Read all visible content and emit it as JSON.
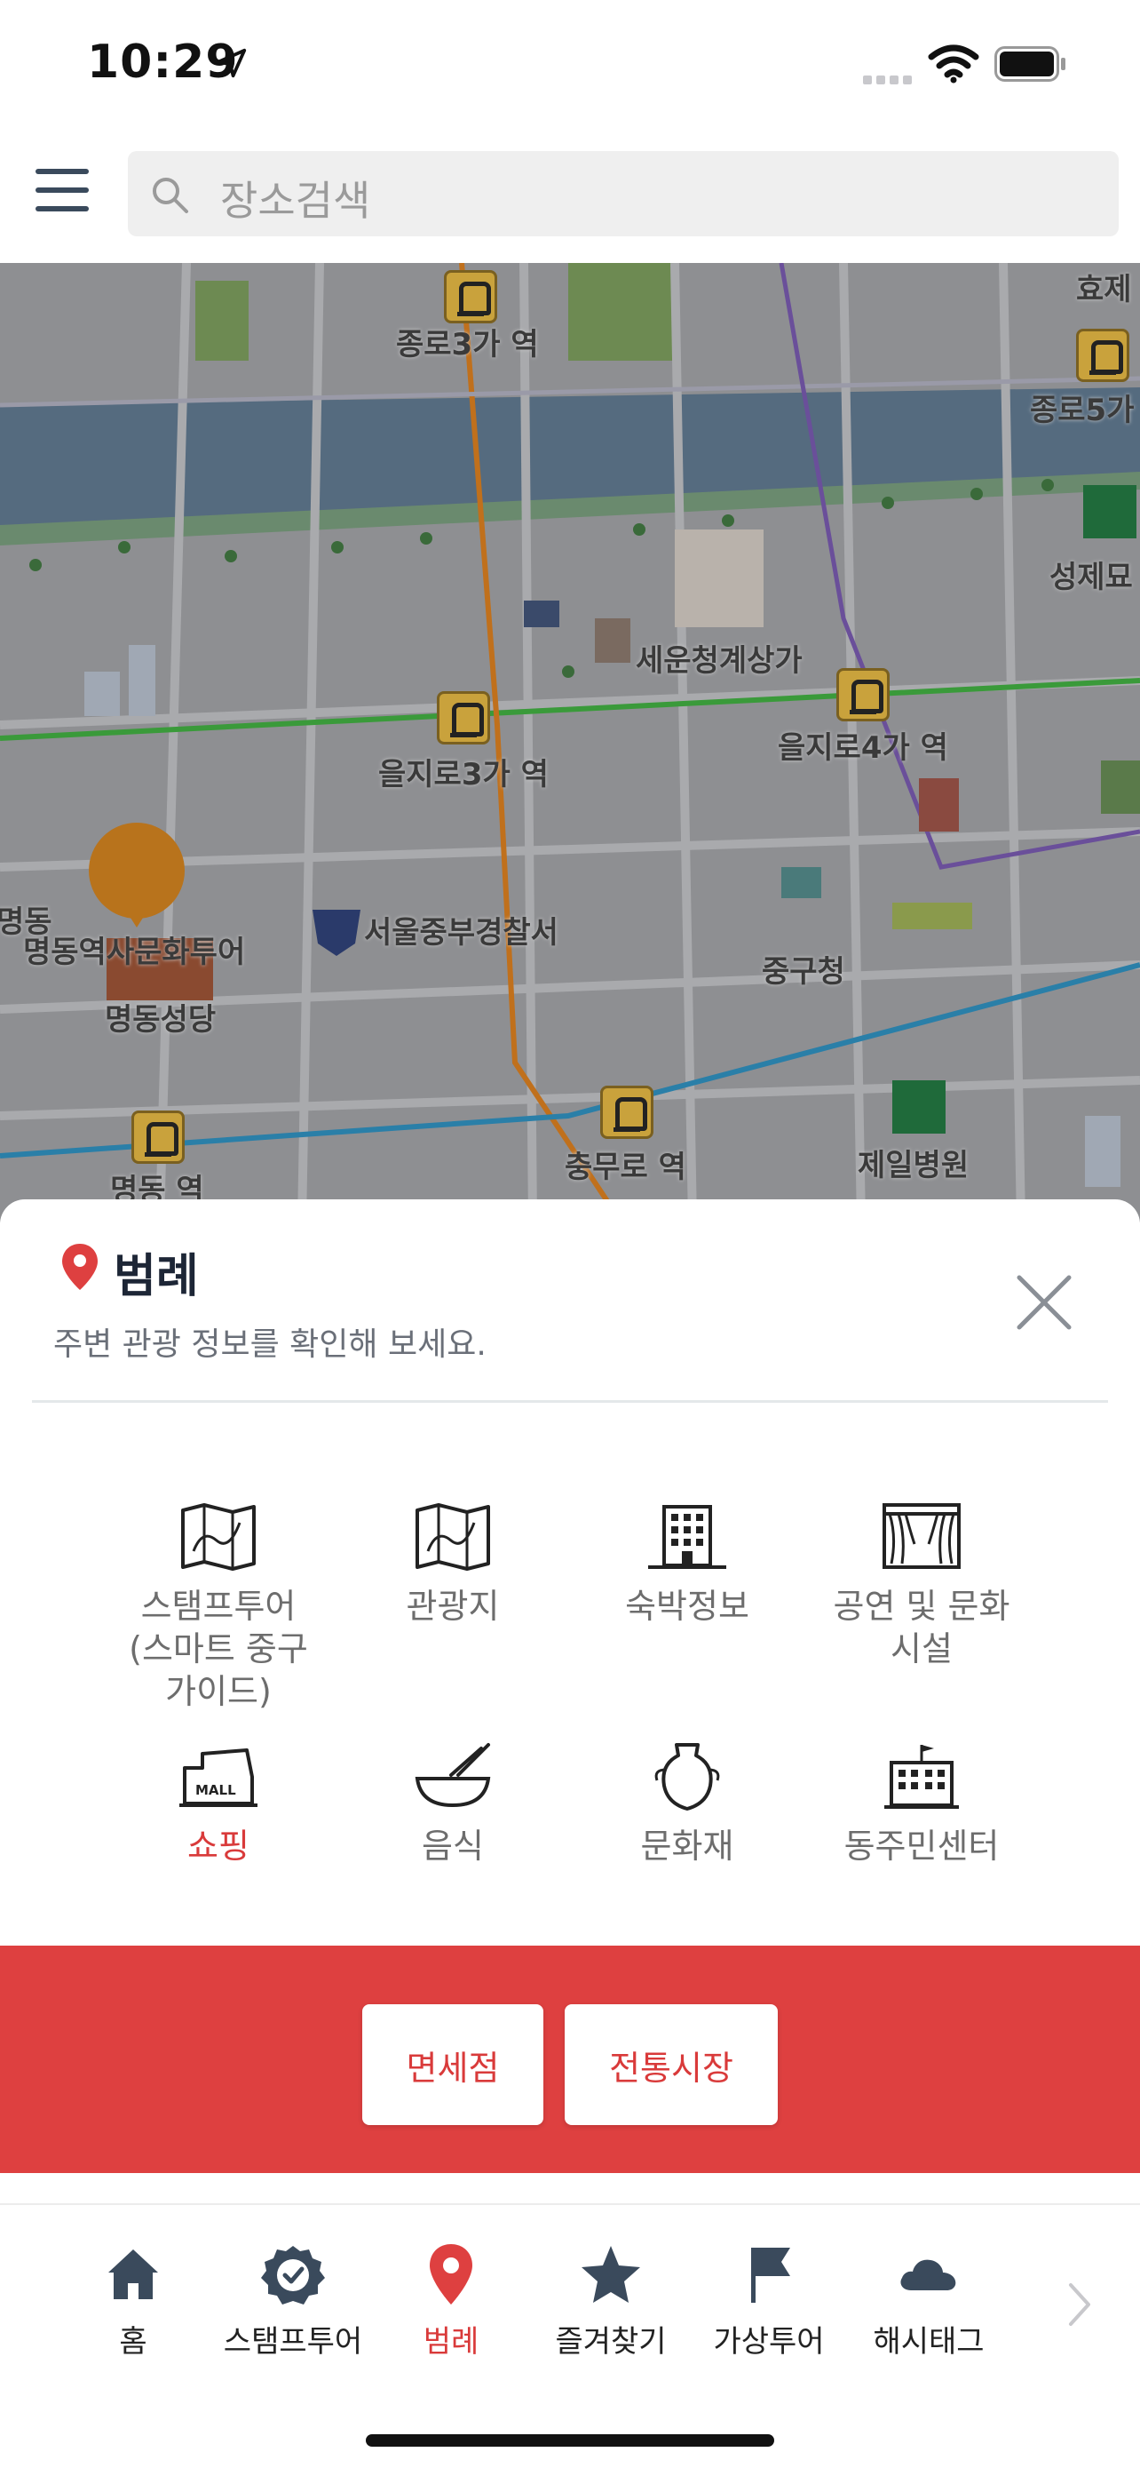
{
  "status_bar": {
    "time": "10:29"
  },
  "search": {
    "placeholder": "장소검색"
  },
  "map": {
    "labels": {
      "jongno3ga": "종로3가 역",
      "jongno5ga": "종로5가",
      "hyoje": "효제",
      "seongjemyo": "성제묘",
      "sewoon": "세운청계상가",
      "euljiro3ga": "을지로3가 역",
      "euljiro4ga": "을지로4가 역",
      "myeongdong_culture": "명동역사문화투어",
      "myeongdong_left": "명동",
      "myeongdong_cathedral": "명동성당",
      "police": "서울중부경찰서",
      "junggu_office": "중구청",
      "myeongdong_station": "명동 역",
      "chungmuro": "충무로 역",
      "jeil_hospital": "제일병원"
    }
  },
  "sheet": {
    "title": "범례",
    "subtitle": "주변 관광 정보를 확인해 보세요.",
    "categories": [
      {
        "label": "스탬프투어\n(스마트 중구\n가이드)",
        "icon": "map-icon"
      },
      {
        "label": "관광지",
        "icon": "map-icon"
      },
      {
        "label": "숙박정보",
        "icon": "building-icon"
      },
      {
        "label": "공연 및 문화\n시설",
        "icon": "theater-icon"
      },
      {
        "label": "쇼핑",
        "icon": "mall-icon",
        "active": true
      },
      {
        "label": "음식",
        "icon": "bowl-icon"
      },
      {
        "label": "문화재",
        "icon": "vase-icon"
      },
      {
        "label": "동주민센터",
        "icon": "community-center-icon"
      }
    ],
    "buttons": {
      "duty_free": "면세점",
      "traditional_market": "전통시장"
    }
  },
  "tabbar": {
    "tabs": [
      {
        "label": "홈",
        "icon": "home-icon"
      },
      {
        "label": "스탬프투어",
        "icon": "badge-icon"
      },
      {
        "label": "범례",
        "icon": "pin-icon",
        "active": true
      },
      {
        "label": "즐겨찾기",
        "icon": "star-icon"
      },
      {
        "label": "가상투어",
        "icon": "flag-icon"
      },
      {
        "label": "해시태그",
        "icon": "cloud-icon"
      }
    ]
  },
  "colors": {
    "accent": "#de4040",
    "nav_dark": "#3a4a5c"
  }
}
